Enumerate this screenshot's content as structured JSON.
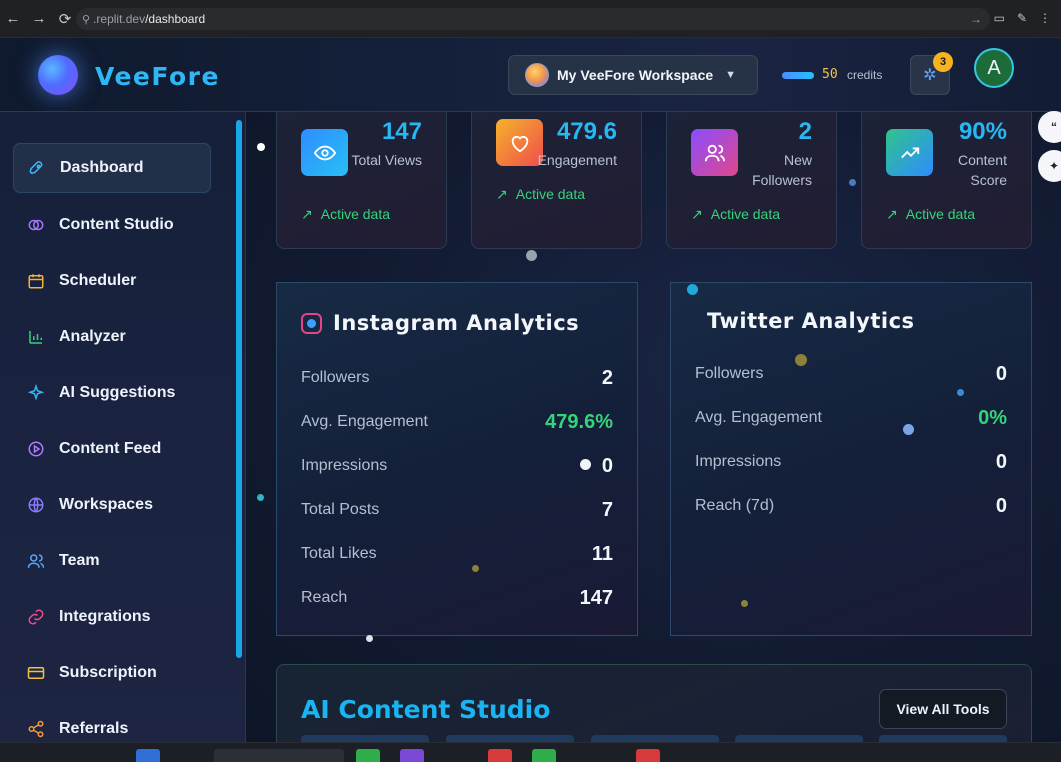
{
  "browser": {
    "url_domain": ".replit.dev",
    "url_path": "/dashboard"
  },
  "header": {
    "logo_text": "VeeFore",
    "workspace_label": "My VeeFore Workspace",
    "credits_value": "50",
    "credits_label": "credits",
    "notification_count": "3",
    "user_initial": "A"
  },
  "sidebar": {
    "items": [
      {
        "label": "Dashboard",
        "icon": "rocket-icon",
        "active": true
      },
      {
        "label": "Content Studio",
        "icon": "brain-icon"
      },
      {
        "label": "Scheduler",
        "icon": "calendar-icon"
      },
      {
        "label": "Analyzer",
        "icon": "bar-chart-icon"
      },
      {
        "label": "AI Suggestions",
        "icon": "sparkles-icon"
      },
      {
        "label": "Content Feed",
        "icon": "play-circle-icon"
      },
      {
        "label": "Workspaces",
        "icon": "globe-icon"
      },
      {
        "label": "Team",
        "icon": "users-icon"
      },
      {
        "label": "Integrations",
        "icon": "link-icon"
      },
      {
        "label": "Subscription",
        "icon": "credit-card-icon"
      },
      {
        "label": "Referrals",
        "icon": "share-icon"
      }
    ]
  },
  "stats": [
    {
      "value": "147",
      "label": "Total Views",
      "status": "Active data",
      "icon": "eye-icon",
      "color": "#2f8cff"
    },
    {
      "value": "479.6",
      "label": "Engagement",
      "status": "Active data",
      "icon": "heart-icon",
      "color": "#f0792a"
    },
    {
      "value": "2",
      "label": "New Followers",
      "status": "Active data",
      "icon": "users-icon",
      "color": "#b64de0"
    },
    {
      "value": "90%",
      "label": "Content Score",
      "status": "Active data",
      "icon": "trend-up-icon",
      "color": "#2fc48a"
    }
  ],
  "instagram": {
    "title": "Instagram Analytics",
    "rows": [
      {
        "label": "Followers",
        "value": "2"
      },
      {
        "label": "Avg. Engagement",
        "value": "479.6%"
      },
      {
        "label": "Impressions",
        "value": "0"
      },
      {
        "label": "Total Posts",
        "value": "7"
      },
      {
        "label": "Total Likes",
        "value": "11"
      },
      {
        "label": "Reach",
        "value": "147"
      }
    ]
  },
  "twitter": {
    "title": "Twitter Analytics",
    "rows": [
      {
        "label": "Followers",
        "value": "0"
      },
      {
        "label": "Avg. Engagement",
        "value": "0%"
      },
      {
        "label": "Impressions",
        "value": "0"
      },
      {
        "label": "Reach (7d)",
        "value": "0"
      }
    ]
  },
  "studio": {
    "title": "AI Content Studio",
    "button_label": "View All Tools"
  }
}
